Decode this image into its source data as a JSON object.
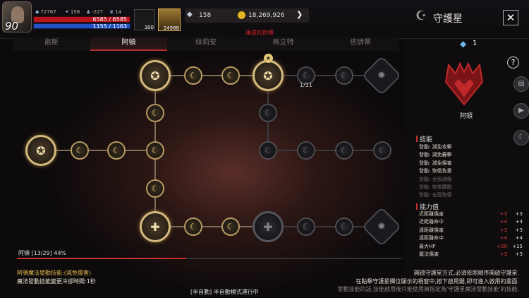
{
  "hud": {
    "level": "90",
    "stat_a": "72767",
    "stat_b": "158",
    "stat_c": "-227",
    "stat_d": "14",
    "hp": "6585 / 6585",
    "mp": "1155 / 1163",
    "quick1_count": "300",
    "quick2_count": "24988",
    "gem": "158",
    "gold": "18,269,926",
    "goal": "達成的目標"
  },
  "window": {
    "title": "守護星",
    "close": "✕"
  },
  "tabs": [
    {
      "label": "亩斯",
      "active": false
    },
    {
      "label": "阿頓",
      "active": true
    },
    {
      "label": "絲莉安",
      "active": false
    },
    {
      "label": "格立特",
      "active": false
    },
    {
      "label": "依詩蒂",
      "active": false
    }
  ],
  "tree": {
    "node_count": "1/11"
  },
  "progress": {
    "label": "阿頓 [13/29] 44%",
    "percent": 44
  },
  "panel": {
    "crystal_count": "1",
    "help": "?",
    "guardian_name": "阿頓",
    "skills_header": "技能",
    "skills": [
      {
        "text": "發動: 減免攻擊",
        "active": true
      },
      {
        "text": "發動: 減免轟擊",
        "active": true
      },
      {
        "text": "發動: 減免傷害",
        "active": true
      },
      {
        "text": "發動: 恢復負重",
        "active": true
      },
      {
        "text": "發動: 全面減傷",
        "active": false
      },
      {
        "text": "發動: 恢復體能",
        "active": false
      },
      {
        "text": "發動: 全面恢復",
        "active": false
      }
    ],
    "stats_header": "能力值",
    "stats": [
      {
        "name": "近距離傷害",
        "add": "+3",
        "total": "+3"
      },
      {
        "name": "近距離命中",
        "add": "+4",
        "total": "+4"
      },
      {
        "name": "遠距離傷害",
        "add": "+3",
        "total": "+3"
      },
      {
        "name": "遠距離命中",
        "add": "+4",
        "total": "+4"
      },
      {
        "name": "最大HP",
        "add": "+50",
        "total": "+15"
      },
      {
        "name": "魔法傷害",
        "add": "+3",
        "total": "+3"
      }
    ]
  },
  "bottom": {
    "left_line1": "阿頓魔法發動技能:(減免傷害)",
    "left_line2": "魔法發動技能變更冷卻時間:1秒",
    "right_line1": "開啟守護星方式,必須依照順序開啟守護星.",
    "right_line2": "在點擊守護星欄位顯示的視窗中,按下啟用鍵,即可進入啟用的畫面.",
    "right_line3": "發動技能的話,技能啟用後只能使用被指定為'守護星魔法發動技能'的技能.",
    "auto": "[半自動] 半自動模式運行中"
  },
  "colors": {
    "accent": "#c9302c",
    "gold": "#d5ba7f",
    "hp": "#b8141c",
    "mp": "#2452c4"
  }
}
